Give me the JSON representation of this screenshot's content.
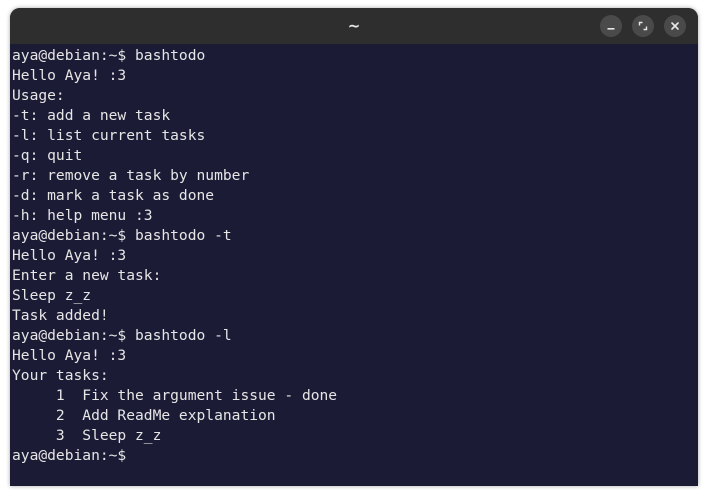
{
  "window": {
    "title": "~",
    "minimize_icon": "minimize-icon",
    "maximize_icon": "maximize-icon",
    "close_icon": "close-icon",
    "background": "#1b1b36",
    "titlebar_color": "#2e2e2e"
  },
  "terminal": {
    "lines": [
      "aya@debian:~$ bashtodo",
      "Hello Aya! :3",
      "Usage:",
      "-t: add a new task",
      "-l: list current tasks",
      "-q: quit",
      "-r: remove a task by number",
      "-d: mark a task as done",
      "-h: help menu :3",
      "aya@debian:~$ bashtodo -t",
      "Hello Aya! :3",
      "Enter a new task:",
      "Sleep z_z",
      "Task added!",
      "aya@debian:~$ bashtodo -l",
      "Hello Aya! :3",
      "Your tasks:",
      "     1  Fix the argument issue - done",
      "     2  Add ReadMe explanation",
      "     3  Sleep z_z",
      "aya@debian:~$ "
    ]
  }
}
